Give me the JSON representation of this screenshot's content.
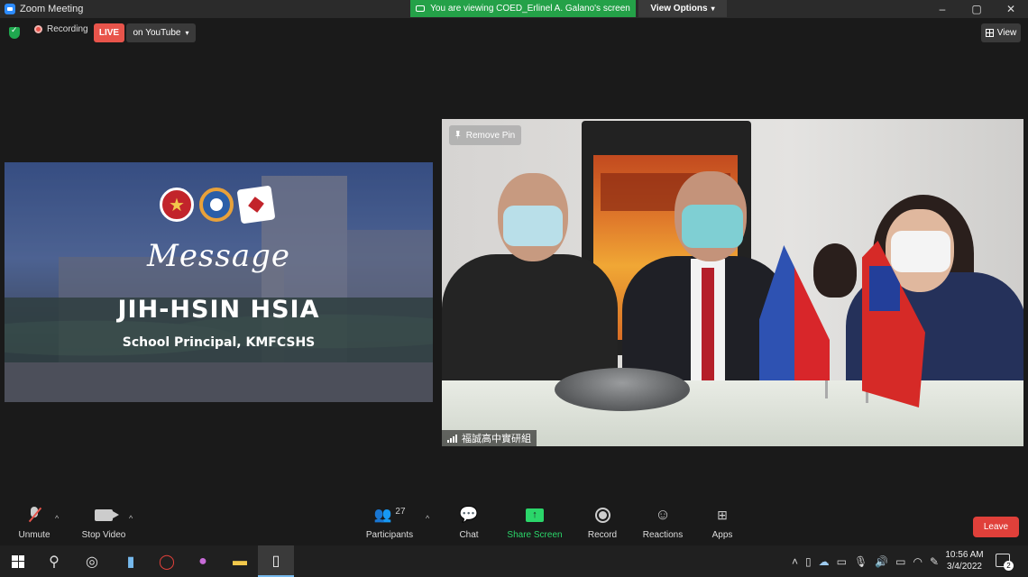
{
  "window": {
    "title": "Zoom Meeting",
    "viewing_banner": "You are viewing COED_Erlinel A. Galano's screen",
    "view_options": "View Options",
    "controls": [
      "–",
      "▢",
      "✕"
    ]
  },
  "topbar": {
    "recording_label": "Recording",
    "live_label": "LIVE",
    "stream_label": "on YouTube",
    "view_label": "View"
  },
  "slide": {
    "heading": "Message",
    "name": "JIH-HSIN HSIA",
    "role": "School Principal, KMFCSHS"
  },
  "video": {
    "remove_pin": "Remove Pin",
    "participant_name": "福誠高中實研組"
  },
  "controls": {
    "unmute": "Unmute",
    "stop_video": "Stop Video",
    "participants": "Participants",
    "participants_count": "27",
    "chat": "Chat",
    "share_screen": "Share Screen",
    "record": "Record",
    "reactions": "Reactions",
    "apps": "Apps",
    "leave": "Leave"
  },
  "taskbar": {
    "time": "10:56 AM",
    "date": "3/4/2022",
    "notification_count": "2"
  },
  "colors": {
    "accent_green": "#24a148",
    "live_red": "#e8544b",
    "leave_red": "#e0403a",
    "share_green": "#2bd66a"
  }
}
